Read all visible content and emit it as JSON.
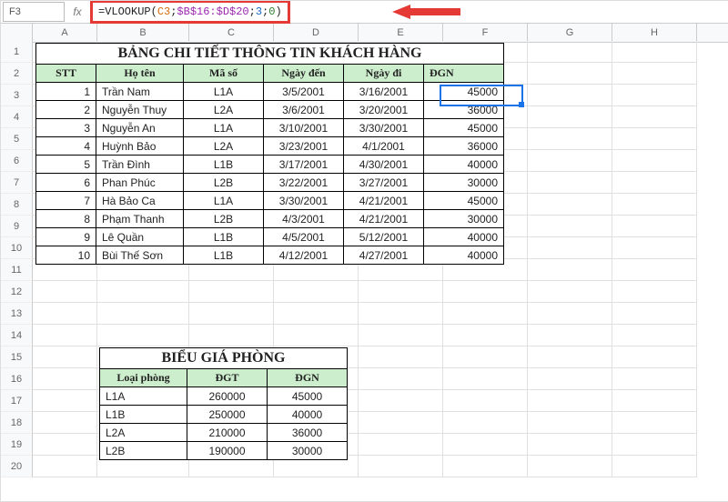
{
  "nameBox": "F3",
  "formula": {
    "prefix": "=VLOOKUP(",
    "arg1": "C3",
    "sep1": ";",
    "arg2": "$B$16:$D$20",
    "sep2": ";",
    "arg3": "3",
    "sep3": ";",
    "arg4": "0",
    "suffix": ")"
  },
  "columns": [
    "A",
    "B",
    "C",
    "D",
    "E",
    "F",
    "G",
    "H"
  ],
  "rows": [
    "1",
    "2",
    "3",
    "4",
    "5",
    "6",
    "7",
    "8",
    "9",
    "10",
    "11",
    "12",
    "13",
    "14",
    "15",
    "16",
    "17",
    "18",
    "19",
    "20"
  ],
  "table1": {
    "title": "BẢNG CHI TIẾT THÔNG TIN KHÁCH HÀNG",
    "headers": [
      "STT",
      "Họ tên",
      "Mã số",
      "Ngày đến",
      "Ngày đi",
      "ĐGN"
    ],
    "rows": [
      [
        "1",
        "Trần Nam",
        "L1A",
        "3/5/2001",
        "3/16/2001",
        "45000"
      ],
      [
        "2",
        "Nguyễn Thuy",
        "L2A",
        "3/6/2001",
        "3/20/2001",
        "36000"
      ],
      [
        "3",
        "Nguyễn An",
        "L1A",
        "3/10/2001",
        "3/30/2001",
        "45000"
      ],
      [
        "4",
        "Huỳnh Bảo",
        "L2A",
        "3/23/2001",
        "4/1/2001",
        "36000"
      ],
      [
        "5",
        "Trần Đình",
        "L1B",
        "3/17/2001",
        "4/30/2001",
        "40000"
      ],
      [
        "6",
        "Phan Phúc",
        "L2B",
        "3/22/2001",
        "3/27/2001",
        "30000"
      ],
      [
        "7",
        "Hà Bảo Ca",
        "L1A",
        "3/30/2001",
        "4/21/2001",
        "45000"
      ],
      [
        "8",
        "Phạm Thanh",
        "L2B",
        "4/3/2001",
        "4/21/2001",
        "30000"
      ],
      [
        "9",
        "Lê Quần",
        "L1B",
        "4/5/2001",
        "5/12/2001",
        "40000"
      ],
      [
        "10",
        "Bùi Thế Sơn",
        "L1B",
        "4/12/2001",
        "4/27/2001",
        "40000"
      ]
    ]
  },
  "table2": {
    "title": "BIỂU GIÁ PHÒNG",
    "headers": [
      "Loại phòng",
      "ĐGT",
      "ĐGN"
    ],
    "rows": [
      [
        "L1A",
        "260000",
        "45000"
      ],
      [
        "L1B",
        "250000",
        "40000"
      ],
      [
        "L2A",
        "210000",
        "36000"
      ],
      [
        "L2B",
        "190000",
        "30000"
      ]
    ]
  },
  "chart_data": {
    "type": "table",
    "tables": [
      {
        "title": "BẢNG CHI TIẾT THÔNG TIN KHÁCH HÀNG",
        "columns": [
          "STT",
          "Họ tên",
          "Mã số",
          "Ngày đến",
          "Ngày đi",
          "ĐGN"
        ],
        "rows": [
          [
            1,
            "Trần Nam",
            "L1A",
            "3/5/2001",
            "3/16/2001",
            45000
          ],
          [
            2,
            "Nguyễn Thuy",
            "L2A",
            "3/6/2001",
            "3/20/2001",
            36000
          ],
          [
            3,
            "Nguyễn An",
            "L1A",
            "3/10/2001",
            "3/30/2001",
            45000
          ],
          [
            4,
            "Huỳnh Bảo",
            "L2A",
            "3/23/2001",
            "4/1/2001",
            36000
          ],
          [
            5,
            "Trần Đình",
            "L1B",
            "3/17/2001",
            "4/30/2001",
            40000
          ],
          [
            6,
            "Phan Phúc",
            "L2B",
            "3/22/2001",
            "3/27/2001",
            30000
          ],
          [
            7,
            "Hà Bảo Ca",
            "L1A",
            "3/30/2001",
            "4/21/2001",
            45000
          ],
          [
            8,
            "Phạm Thanh",
            "L2B",
            "4/3/2001",
            "4/21/2001",
            30000
          ],
          [
            9,
            "Lê Quần",
            "L1B",
            "4/5/2001",
            "5/12/2001",
            40000
          ],
          [
            10,
            "Bùi Thế Sơn",
            "L1B",
            "4/12/2001",
            "4/27/2001",
            40000
          ]
        ]
      },
      {
        "title": "BIỂU GIÁ PHÒNG",
        "columns": [
          "Loại phòng",
          "ĐGT",
          "ĐGN"
        ],
        "rows": [
          [
            "L1A",
            260000,
            45000
          ],
          [
            "L1B",
            250000,
            40000
          ],
          [
            "L2A",
            210000,
            36000
          ],
          [
            "L2B",
            190000,
            30000
          ]
        ]
      }
    ]
  }
}
